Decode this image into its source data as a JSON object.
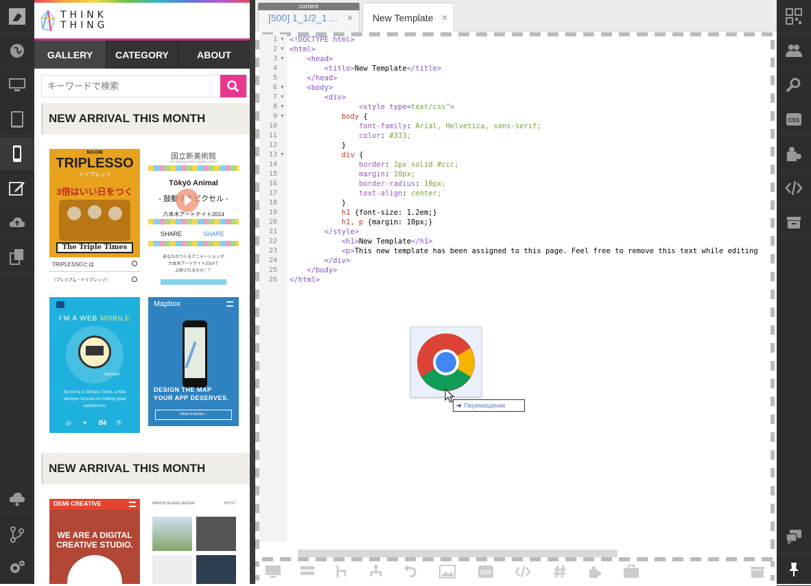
{
  "logo": {
    "line1": "THINK",
    "line2": "THING"
  },
  "nav": [
    {
      "label": "GALLERY"
    },
    {
      "label": "CATEGORY"
    },
    {
      "label": "ABOUT"
    }
  ],
  "search": {
    "placeholder": "キーワードで検索"
  },
  "sections": [
    {
      "title": "NEW ARRIVAL THIS MONTH"
    },
    {
      "title": "NEW ARRIVAL THIS MONTH"
    }
  ],
  "thumbs": {
    "triplesso": {
      "brand": "MAXIM",
      "title": "TRIPLESSO",
      "sub": "トリプレッソ",
      "tagline": "3倍はいい日をつくる。",
      "banner": "The Triple Times",
      "caption": "TRIPLESSOとは",
      "caption2": "〈プレミアム・トリプレッソ〉"
    },
    "tokyo": {
      "header": "国立新美術館",
      "sub": "THE NATIONAL ART CENTER, TOKYO",
      "title": "Tōkyō Animal",
      "tag": "- 鼓動するピクセル -",
      "event": "六本木アートナイト2014",
      "share1": "SHARE",
      "share2": "SHARE",
      "body1": "あなたのつくるアニメーションが",
      "body2": "六本木アートナイト2014で",
      "body3": "上映されるかも！？"
    },
    "mobile": {
      "title1": "I'M A WEB",
      "title2": "MOBILE",
      "sign": "Samurai",
      "body": "My name is Stefano Tirloni, a Web designer focused on crafting great experiences."
    },
    "mapbox": {
      "title": "Mapbox",
      "headline1": "DESIGN THE MAP",
      "headline2": "YOUR APP DESERVES.",
      "cta": "How it works ↓"
    },
    "demi": {
      "brand": "DEMI CREATIVE",
      "headline1": "WE ARE A DIGITAL",
      "headline2": "CREATIVE STUDIO."
    },
    "nippon": {
      "brand": "NIPPON DESIGN CENTER",
      "menu": "MENU"
    }
  },
  "tabs": [
    {
      "label": "[500] 1_1/2_1 ...",
      "badge": "current"
    },
    {
      "label": "New Template"
    }
  ],
  "code_lines": [
    "<!DOCTYPE html>",
    "<html>",
    "    <head>",
    "        <title>New Template</title>",
    "    </head>",
    "    <body>",
    "        <div>",
    "                <style type=\"text/css\">",
    "            body {",
    "                font-family: Arial, Helvetica, sans-serif;",
    "                color: #333;",
    "            }",
    "            div {",
    "                border: 1px solid #ccc;",
    "                margin: 10px;",
    "                border-radius: 10px;",
    "                text-align: center;",
    "            }",
    "            h1 {font-size: 1.2em;}",
    "            h1, p {margin: 10px;}",
    "        </style>",
    "            <h1>New Template</h1>",
    "            <p>This new template has been assigned to this page. Feel free to remove this text while editing",
    "        </div>",
    "    </body>",
    "</html>"
  ],
  "drag": {
    "tooltip": "Перемещение"
  },
  "colors": {
    "rail": "#2d2d2d",
    "accent": "#e8388e",
    "nav": "#333333"
  }
}
